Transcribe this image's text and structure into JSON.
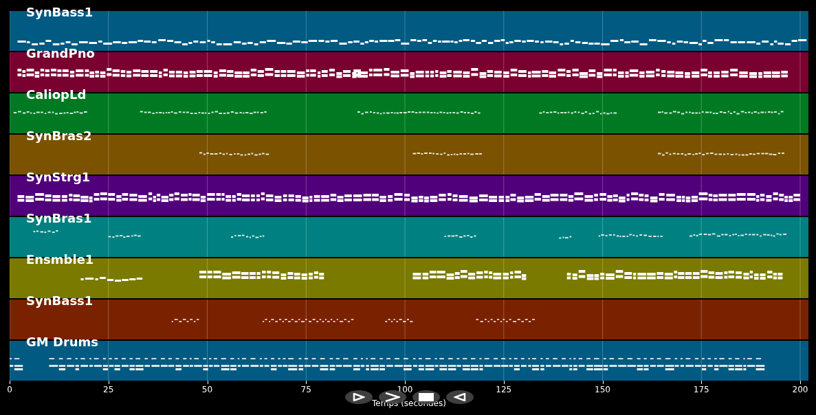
{
  "tracks": [
    {
      "name": "SynBass1",
      "color": "#005a82"
    },
    {
      "name": "GrandPno",
      "color": "#7a0030"
    },
    {
      "name": "CaliopLd",
      "color": "#007a22"
    },
    {
      "name": "SynBras2",
      "color": "#7a5200"
    },
    {
      "name": "SynStrg1",
      "color": "#50007a"
    },
    {
      "name": "SynBras1",
      "color": "#008080"
    },
    {
      "name": "Ensmble1",
      "color": "#7a7a00"
    },
    {
      "name": "SynBass1",
      "color": "#7a2200"
    },
    {
      "name": "GM Drums",
      "color": "#005a82"
    }
  ],
  "axis": {
    "ticks": [
      "0",
      "25",
      "50",
      "75",
      "100",
      "125",
      "150",
      "175",
      "200"
    ],
    "title": "Temps (secondes)"
  },
  "controls": [
    {
      "kind": "play"
    },
    {
      "kind": "next"
    },
    {
      "kind": "stop"
    },
    {
      "kind": "back"
    }
  ]
}
